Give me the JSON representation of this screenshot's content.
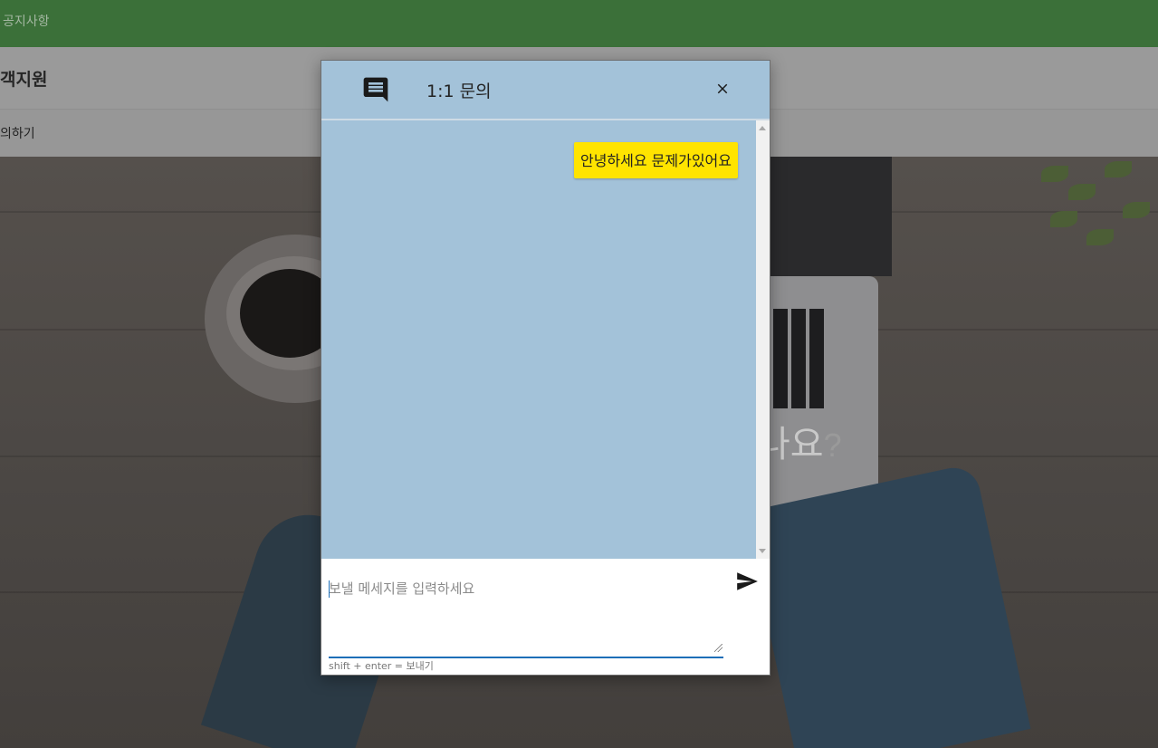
{
  "background_page": {
    "topbar": {
      "nav_item": "공지사항"
    },
    "subheader": {
      "title": "객지원"
    },
    "subnav": {
      "item": "의하기"
    },
    "hero": {
      "text": "나요",
      "question_mark": "?"
    }
  },
  "chat_dialog": {
    "title": "1:1 문의",
    "header_icon": "chat-icon",
    "close_icon": "close-icon",
    "messages": [
      {
        "text": "안녕하세요 문제가있어요",
        "side": "right",
        "color": "#ffe400"
      }
    ],
    "input": {
      "placeholder": "보낼 메세지를 입력하세요",
      "value": ""
    },
    "send_icon": "send-icon",
    "hint": "shift + enter = 보내기"
  },
  "colors": {
    "topbar": "#3b7039",
    "dialog_header": "#a3c2d9",
    "message_area": "#a3c2d9",
    "bubble": "#ffe400",
    "input_underline": "#1e6fb8"
  }
}
